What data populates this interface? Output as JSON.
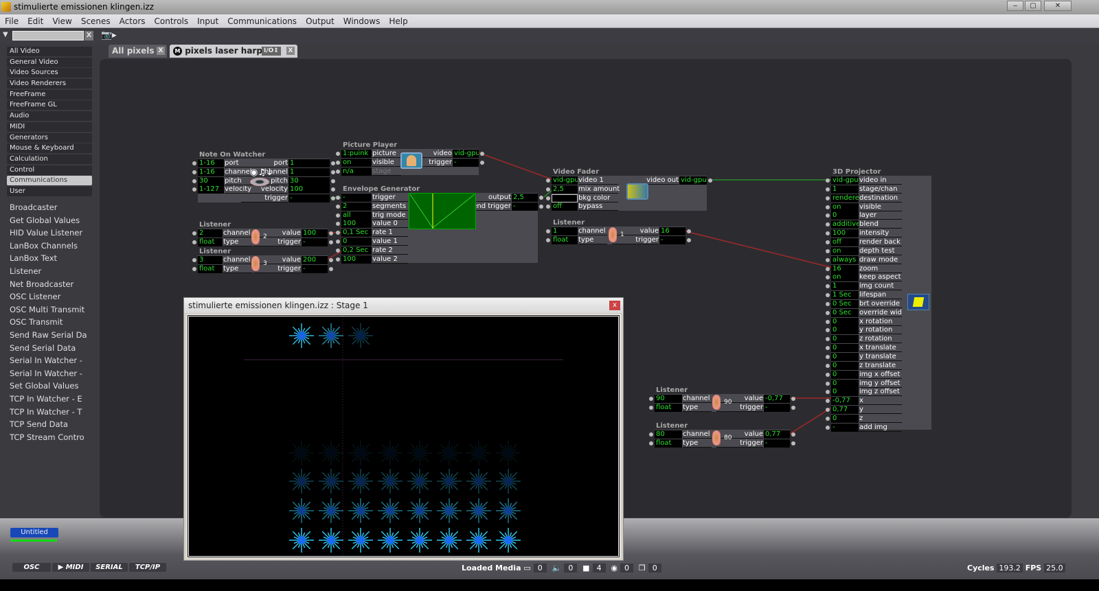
{
  "window": {
    "title": "stimulierte emissionen klingen.izz",
    "minimize": "‒",
    "maximize": "▢",
    "close": "✕"
  },
  "menu": [
    "File",
    "Edit",
    "View",
    "Scenes",
    "Actors",
    "Controls",
    "Input",
    "Communications",
    "Output",
    "Windows",
    "Help"
  ],
  "search": {
    "value": "",
    "clear": "X"
  },
  "categories": [
    "All Video",
    "General Video",
    "Video Sources",
    "Video Renderers",
    "FreeFrame",
    "FreeFrame GL",
    "Audio",
    "MIDI",
    "Generators",
    "Mouse & Keyboard",
    "Calculation",
    "Control",
    "Communications",
    "User"
  ],
  "selected_category": "Communications",
  "actors": [
    "Broadcaster",
    "Get Global Values",
    "HID Value Listener",
    "LanBox Channels",
    "LanBox Text",
    "Listener",
    "Net Broadcaster",
    "OSC Listener",
    "OSC Multi Transmit",
    "OSC Transmit",
    "Send Raw Serial Da",
    "Send Serial Data",
    "Serial In Watcher -",
    "Serial In Watcher -",
    "Set Global Values",
    "TCP In Watcher - E",
    "TCP In Watcher - T",
    "TCP Send Data",
    "TCP Stream Contro"
  ],
  "tabs": [
    {
      "label": "All pixels",
      "close": "X"
    },
    {
      "label": "pixels laser harp",
      "badge": "I/O⇕",
      "close": "X",
      "icon": "M"
    }
  ],
  "nodes": {
    "note_on": {
      "title": "Note On Watcher",
      "inputs": [
        [
          "1-16",
          "port"
        ],
        [
          "1-16",
          "channel"
        ],
        [
          "30",
          "pitch"
        ],
        [
          "1-127",
          "velocity"
        ]
      ],
      "outputs": [
        [
          "port",
          "1"
        ],
        [
          "channel",
          "1"
        ],
        [
          "pitch",
          "30"
        ],
        [
          "velocity",
          "100"
        ],
        [
          "trigger",
          "-"
        ]
      ],
      "icon": "midi-eye-icon"
    },
    "picture": {
      "title": "Picture Player",
      "inputs": [
        [
          "1:puink",
          "picture"
        ],
        [
          "on",
          "visible"
        ],
        [
          "n/a",
          "stage"
        ]
      ],
      "outputs": [
        [
          "video",
          "vid-gpu"
        ],
        [
          "trigger",
          "-"
        ]
      ],
      "icon": "picture-thumbnail-icon"
    },
    "envelope": {
      "title": "Envelope Generator",
      "inputs": [
        [
          "-",
          "trigger"
        ],
        [
          "2",
          "segments"
        ],
        [
          "all",
          "trig mode"
        ],
        [
          "100",
          "value 0"
        ],
        [
          "0,1 Sec",
          "rate 1"
        ],
        [
          "0",
          "value 1"
        ],
        [
          "0,2 Sec",
          "rate 2"
        ],
        [
          "100",
          "value 2"
        ]
      ],
      "outputs": [
        [
          "output",
          "2,5"
        ],
        [
          "end trigger",
          "-"
        ]
      ],
      "icon": "envelope-graph"
    },
    "listener2": {
      "title": "Listener",
      "inputs": [
        [
          "2",
          "channel"
        ],
        [
          "float",
          "type"
        ]
      ],
      "outputs": [
        [
          "value",
          "100"
        ],
        [
          "trigger",
          "-"
        ]
      ],
      "channel_display": "2",
      "icon": "ear-icon"
    },
    "listener3": {
      "title": "Listener",
      "inputs": [
        [
          "3",
          "channel"
        ],
        [
          "float",
          "type"
        ]
      ],
      "outputs": [
        [
          "value",
          "200"
        ],
        [
          "trigger",
          "-"
        ]
      ],
      "channel_display": "3",
      "icon": "ear-icon"
    },
    "fader": {
      "title": "Video Fader",
      "inputs": [
        [
          "vid-gpu",
          "video 1"
        ],
        [
          "2,5",
          "mix amount"
        ],
        [
          "",
          "bkg color"
        ],
        [
          "off",
          "bypass"
        ]
      ],
      "outputs": [
        [
          "video out",
          "vid-gpu"
        ]
      ],
      "icon": "fader-icon"
    },
    "listener1": {
      "title": "Listener",
      "inputs": [
        [
          "1",
          "channel"
        ],
        [
          "float",
          "type"
        ]
      ],
      "outputs": [
        [
          "value",
          "16"
        ],
        [
          "trigger",
          "-"
        ]
      ],
      "channel_display": "1",
      "icon": "ear-icon"
    },
    "projector": {
      "title": "3D Projector",
      "inputs": [
        [
          "vid-gpu",
          "video in"
        ],
        [
          "1",
          "stage/chan"
        ],
        [
          "rendere",
          "destination"
        ],
        [
          "on",
          "visible"
        ],
        [
          "0",
          "layer"
        ],
        [
          "additive",
          "blend"
        ],
        [
          "100",
          "intensity"
        ],
        [
          "off",
          "render back"
        ],
        [
          "on",
          "depth test"
        ],
        [
          "always",
          "draw mode"
        ],
        [
          "16",
          "zoom"
        ],
        [
          "on",
          "keep aspect"
        ],
        [
          "1",
          "img count"
        ],
        [
          "1 Sec",
          "lifespan"
        ],
        [
          "0 Sec",
          "brt override"
        ],
        [
          "0 Sec",
          "override wid"
        ],
        [
          "0",
          "x rotation"
        ],
        [
          "0",
          "y rotation"
        ],
        [
          "0",
          "z rotation"
        ],
        [
          "0",
          "x translate"
        ],
        [
          "0",
          "y translate"
        ],
        [
          "0",
          "z translate"
        ],
        [
          "0",
          "img x offset"
        ],
        [
          "0",
          "img y offset"
        ],
        [
          "0",
          "img z offset"
        ],
        [
          "-0,77",
          "x"
        ],
        [
          "0,77",
          "y"
        ],
        [
          "0",
          "z"
        ],
        [
          "-",
          "add img"
        ]
      ],
      "outputs": [],
      "icon": "cube-icon"
    },
    "listener90": {
      "title": "Listener",
      "inputs": [
        [
          "90",
          "channel"
        ],
        [
          "float",
          "type"
        ]
      ],
      "outputs": [
        [
          "value",
          "-0,77"
        ],
        [
          "trigger",
          "-"
        ]
      ],
      "channel_display": "90",
      "icon": "ear-icon"
    },
    "listener80": {
      "title": "Listener",
      "inputs": [
        [
          "80",
          "channel"
        ],
        [
          "float",
          "type"
        ]
      ],
      "outputs": [
        [
          "value",
          "0,77"
        ],
        [
          "trigger",
          "-"
        ]
      ],
      "channel_display": "80",
      "icon": "ear-icon"
    }
  },
  "stage": {
    "title": "stimulierte emissionen klingen.izz : Stage 1",
    "close": "x"
  },
  "scene": {
    "label": "Untitled"
  },
  "comm_buttons": [
    "OSC",
    "▶ MIDI",
    "SERIAL",
    "TCP/IP"
  ],
  "status": {
    "loaded_media_label": "Loaded Media",
    "movies": "0",
    "sounds": "0",
    "pictures": "4",
    "midi": "0",
    "3d": "0"
  },
  "perf": {
    "cycles_label": "Cycles",
    "cycles": "193.2",
    "fps_label": "FPS",
    "fps": "25.0"
  },
  "colors": {
    "value_text": "#2ee02e",
    "wire_video": "#2a8a2a",
    "wire_data": "#a02828",
    "scene_button": "#1848b8"
  }
}
